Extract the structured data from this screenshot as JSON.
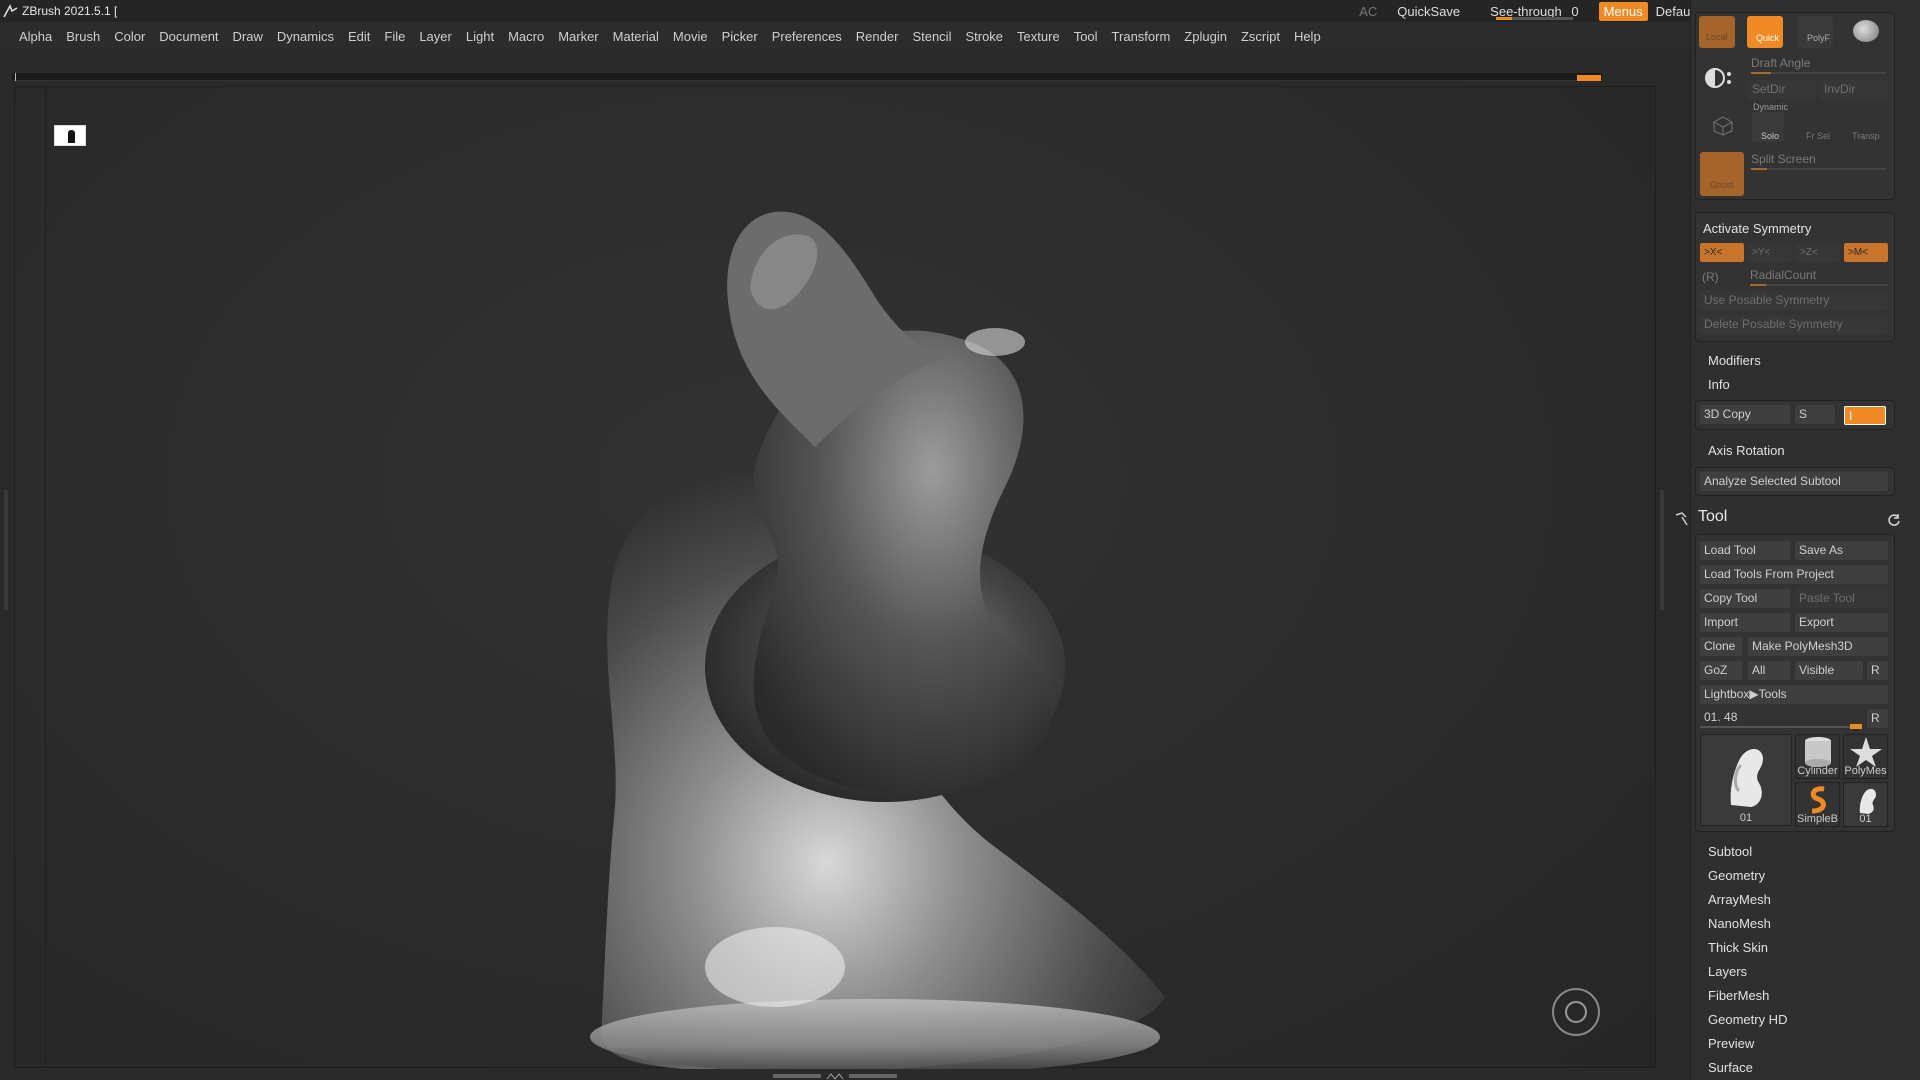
{
  "app": {
    "title": "ZBrush 2021.5.1 ["
  },
  "titlebar": {
    "ac": "AC",
    "quicksave": "QuickSave",
    "see_through_label": "See-through",
    "see_through_value": "0",
    "menus": "Menus",
    "script": "DefaultZScript"
  },
  "menubar": {
    "items": [
      "Alpha",
      "Brush",
      "Color",
      "Document",
      "Draw",
      "Dynamics",
      "Edit",
      "File",
      "Layer",
      "Light",
      "Macro",
      "Marker",
      "Material",
      "Movie",
      "Picker",
      "Preferences",
      "Render",
      "Stencil",
      "Stroke",
      "Texture",
      "Tool",
      "Transform",
      "Zplugin",
      "Zscript",
      "Help"
    ]
  },
  "top_panel": {
    "local": "Local",
    "quick": "Quick",
    "polyf": "PolyF",
    "draft_angle": "Draft Angle",
    "setdir": "SetDir",
    "invdir": "InvDir",
    "dynamic": "Dynamic",
    "solo": "Solo",
    "fr_sel": "Fr Sel",
    "transp": "Transp",
    "ghost": "Ghost",
    "split_screen": "Split Screen"
  },
  "symmetry": {
    "activate": "Activate Symmetry",
    "x": ">X<",
    "y": ">Y<",
    "z": ">Z<",
    "m": ">M<",
    "r": "(R)",
    "radial_count": "RadialCount",
    "use_posable": "Use Posable Symmetry",
    "delete_posable": "Delete Posable Symmetry"
  },
  "panels": {
    "modifiers": "Modifiers",
    "info": "Info",
    "axis_rotation": "Axis Rotation",
    "analyze": "Analyze Selected Subtool"
  },
  "copy3d": {
    "label": "3D Copy",
    "s": "S",
    "i": "I"
  },
  "tool": {
    "title": "Tool",
    "load_tool": "Load Tool",
    "save_as": "Save As",
    "load_from_project": "Load Tools From Project",
    "copy_tool": "Copy Tool",
    "paste_tool": "Paste Tool",
    "import": "Import",
    "export": "Export",
    "clone": "Clone",
    "make_polymesh": "Make PolyMesh3D",
    "goz": "GoZ",
    "all": "All",
    "visible": "Visible",
    "r": "R",
    "lightbox_tools": "Lightbox▶Tools",
    "current_value": "01. 48",
    "slider_r": "R",
    "thumbs": [
      {
        "name": "01"
      },
      {
        "name": "Cylinder"
      },
      {
        "name": "PolyMes"
      },
      {
        "name": "SimpleB"
      },
      {
        "name": "01"
      }
    ]
  },
  "subpalettes": [
    "Subtool",
    "Geometry",
    "ArrayMesh",
    "NanoMesh",
    "Thick Skin",
    "Layers",
    "FiberMesh",
    "Geometry HD",
    "Preview",
    "Surface"
  ],
  "colors": {
    "accent": "#f08a24",
    "bg": "#2a2a2a",
    "panel": "#2f2f2f"
  }
}
